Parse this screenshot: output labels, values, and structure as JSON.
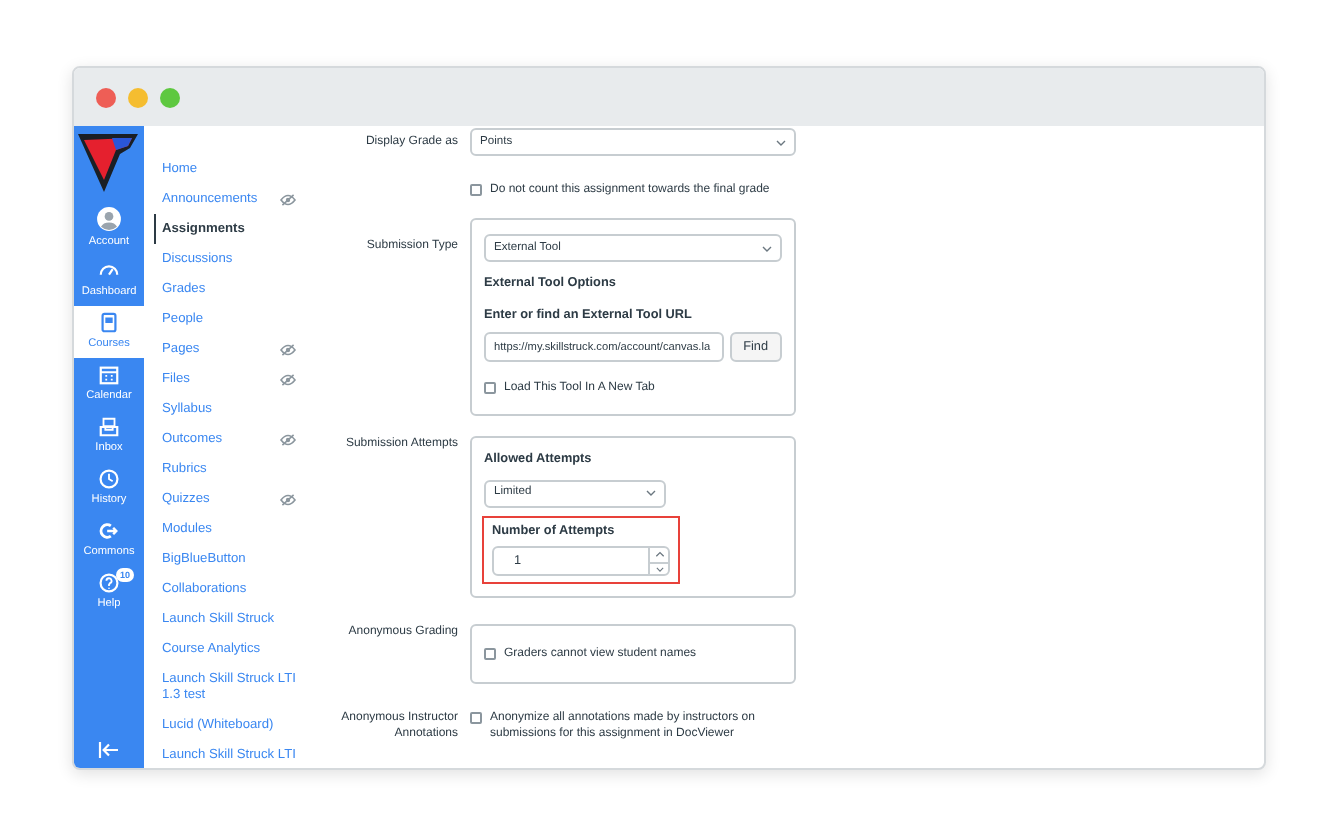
{
  "global_nav": {
    "items": [
      {
        "kind": "account",
        "label": "Account",
        "selected": false
      },
      {
        "kind": "dashboard",
        "label": "Dashboard",
        "selected": false
      },
      {
        "kind": "courses",
        "label": "Courses",
        "selected": true
      },
      {
        "kind": "calendar",
        "label": "Calendar",
        "selected": false
      },
      {
        "kind": "inbox",
        "label": "Inbox",
        "selected": false
      },
      {
        "kind": "history",
        "label": "History",
        "selected": false
      },
      {
        "kind": "commons",
        "label": "Commons",
        "selected": false
      },
      {
        "kind": "help",
        "label": "Help",
        "selected": false,
        "badge": "10"
      }
    ]
  },
  "course_nav": {
    "items": [
      {
        "label": "Home",
        "selected": false,
        "hidden": false
      },
      {
        "label": "Announcements",
        "selected": false,
        "hidden": true
      },
      {
        "label": "Assignments",
        "selected": true,
        "hidden": false
      },
      {
        "label": "Discussions",
        "selected": false,
        "hidden": false
      },
      {
        "label": "Grades",
        "selected": false,
        "hidden": false
      },
      {
        "label": "People",
        "selected": false,
        "hidden": false
      },
      {
        "label": "Pages",
        "selected": false,
        "hidden": true
      },
      {
        "label": "Files",
        "selected": false,
        "hidden": true
      },
      {
        "label": "Syllabus",
        "selected": false,
        "hidden": false
      },
      {
        "label": "Outcomes",
        "selected": false,
        "hidden": true
      },
      {
        "label": "Rubrics",
        "selected": false,
        "hidden": false
      },
      {
        "label": "Quizzes",
        "selected": false,
        "hidden": true
      },
      {
        "label": "Modules",
        "selected": false,
        "hidden": false
      },
      {
        "label": "BigBlueButton",
        "selected": false,
        "hidden": false
      },
      {
        "label": "Collaborations",
        "selected": false,
        "hidden": false
      },
      {
        "label": "Launch Skill Struck",
        "selected": false,
        "hidden": false
      },
      {
        "label": "Course Analytics",
        "selected": false,
        "hidden": false
      },
      {
        "label": "Launch Skill Struck LTI 1.3 test",
        "selected": false,
        "hidden": false
      },
      {
        "label": "Lucid (Whiteboard)",
        "selected": false,
        "hidden": false
      },
      {
        "label": "Launch Skill Struck LTI",
        "selected": false,
        "hidden": false
      }
    ]
  },
  "form": {
    "rows": [
      {
        "kind": "select",
        "label": "Display Grade as",
        "value": "Points"
      },
      {
        "kind": "checkbox",
        "text": "Do not count this assignment towards the final grade",
        "checked": false
      },
      {
        "kind": "submission",
        "label": "Submission Type",
        "value": "External Tool",
        "heading": "External Tool Options",
        "url_label": "Enter or find an External Tool URL",
        "url": "https://my.skillstruck.com/account/canvas.la",
        "button": "Find",
        "new_tab": {
          "text": "Load This Tool In A New Tab",
          "checked": false
        }
      },
      {
        "kind": "attempts",
        "label": "Submission Attempts",
        "heading": "Allowed Attempts",
        "value": "Limited",
        "number_label": "Number of Attempts",
        "number": "1",
        "highlighted": true
      },
      {
        "kind": "boxcheck",
        "label": "Anonymous Grading",
        "text": "Graders cannot view student names",
        "checked": false
      },
      {
        "kind": "inlinecheck",
        "label": "Anonymous Instructor Annotations",
        "text": "Anonymize all annotations made by instructors on submissions for this assignment in DocViewer",
        "checked": false
      }
    ]
  }
}
